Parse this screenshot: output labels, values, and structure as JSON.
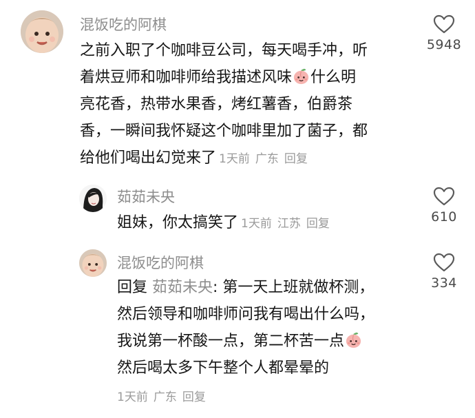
{
  "comments": [
    {
      "username": "混饭吃的阿棋",
      "lines": [
        "之前入职了个咖啡豆公司，每天喝手冲，听",
        "着烘豆师和咖啡师给我描述风味",
        "亮花香，热带水果香，烤红薯香，伯爵茶",
        "香，一瞬间我怀疑这个咖啡里加了菌子，都",
        "给他们喝出幻觉来了"
      ],
      "line2_tail": "什么明",
      "time": "1天前",
      "location": "广东",
      "reply_label": "回复",
      "likes": "5948"
    },
    {
      "username": "茹茹未央",
      "text": "姐妹，你太搞笑了",
      "time": "1天前",
      "location": "江苏",
      "reply_label": "回复",
      "likes": "610"
    },
    {
      "username": "混饭吃的阿棋",
      "reply_prefix": "回复",
      "mention": "茹茹未央",
      "first_line_rest": ": 第一天上班就做杯测，",
      "lines": [
        "然后领导和咖啡师问我有喝出什么吗，",
        "我说第一杯酸一点，第二杯苦一点",
        "然后喝太多下午整个人都晕晕的"
      ],
      "time": "1天前",
      "location": "广东",
      "reply_label": "回复",
      "likes": "334"
    }
  ],
  "icons": {
    "like": "heart-outline-icon",
    "emoji": "peach-face-emoji-icon"
  },
  "colors": {
    "username": "#8d8d8d",
    "meta": "#9a9a9a",
    "text": "#161616",
    "emoji": "#f2a6a6"
  }
}
